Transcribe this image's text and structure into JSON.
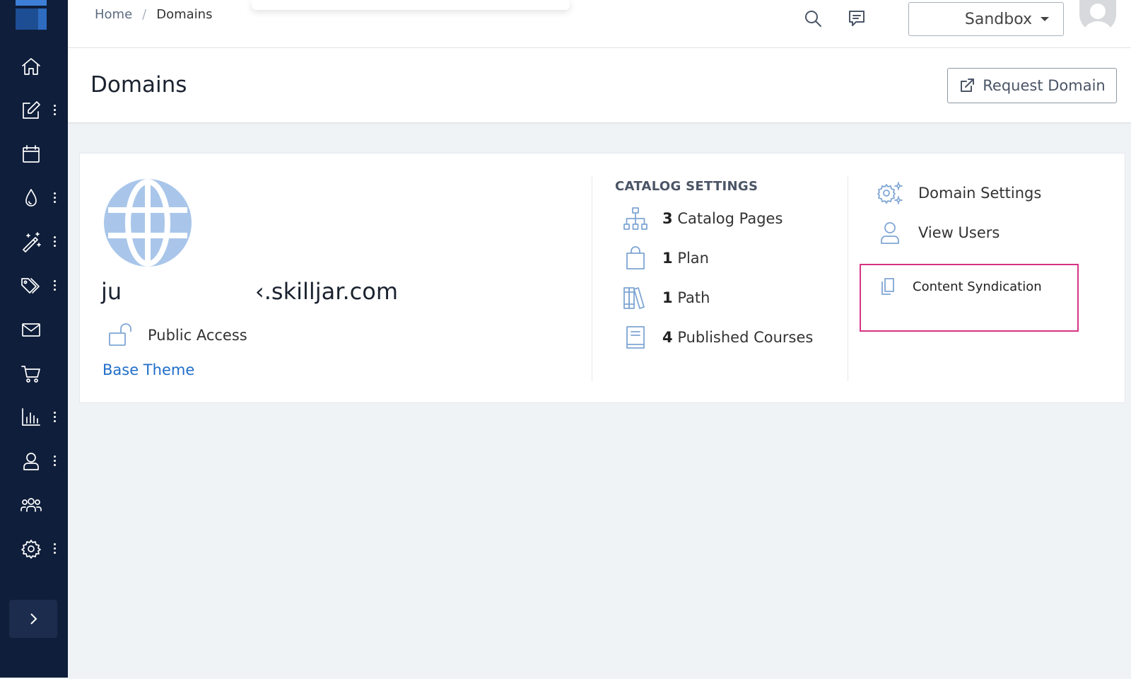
{
  "breadcrumb": {
    "home": "Home",
    "separator": "/",
    "current": "Domains"
  },
  "topbar": {
    "environment": "Sandbox"
  },
  "header": {
    "title": "Domains",
    "request_button": "Request Domain"
  },
  "domain": {
    "name_prefix": "ju",
    "name_suffix": "‹.skilljar.com",
    "access": "Public Access",
    "theme": "Base Theme"
  },
  "catalog": {
    "title": "CATALOG SETTINGS",
    "items": [
      {
        "count": "3",
        "label": "Catalog Pages",
        "icon": "sitemap-icon"
      },
      {
        "count": "1",
        "label": "Plan",
        "icon": "shopping-bag-icon"
      },
      {
        "count": "1",
        "label": "Path",
        "icon": "books-icon"
      },
      {
        "count": "4",
        "label": "Published Courses",
        "icon": "book-icon"
      }
    ]
  },
  "actions": {
    "domain_settings": "Domain Settings",
    "view_users": "View Users",
    "content_syndication": "Content Syndication"
  },
  "colors": {
    "sidebar": "#0f1e3a",
    "accent_icon": "#7fa6d4",
    "link": "#1f6ec9",
    "highlight": "#d63384"
  }
}
